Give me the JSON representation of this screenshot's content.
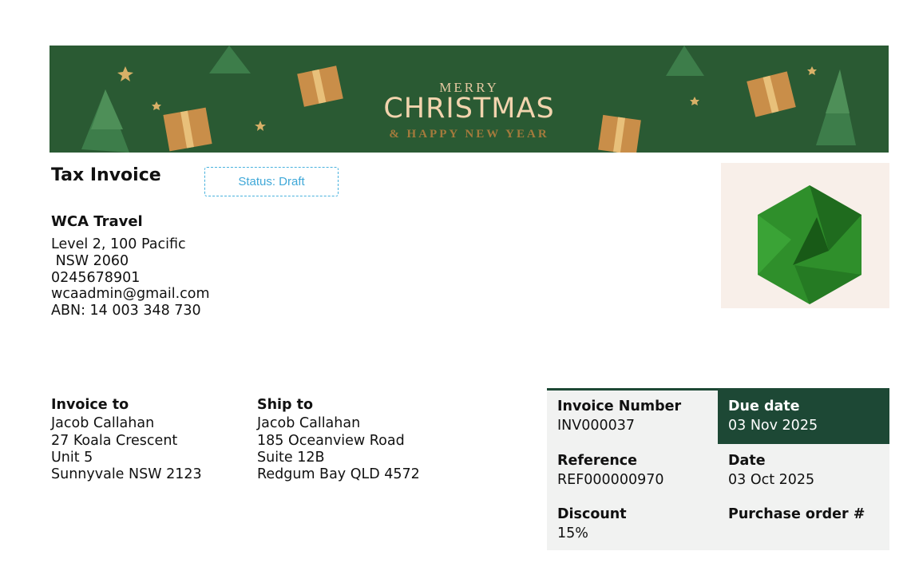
{
  "banner": {
    "line1": "MERRY",
    "line2": "CHRISTMAS",
    "line3": "& HAPPY NEW YEAR"
  },
  "document": {
    "title": "Tax Invoice",
    "status": "Status: Draft"
  },
  "company": {
    "name": "WCA Travel",
    "address_line1": "Level 2, 100 Pacific",
    "address_line2": " NSW 2060",
    "phone": "0245678901",
    "email": "wcaadmin@gmail.com",
    "abn": "ABN: 14 003 348 730"
  },
  "invoice_to": {
    "heading": "Invoice to",
    "lines": [
      "Jacob Callahan",
      "27 Koala Crescent",
      "Unit 5",
      "Sunnyvale NSW 2123"
    ]
  },
  "ship_to": {
    "heading": "Ship to",
    "lines": [
      "Jacob Callahan",
      "185 Oceanview Road",
      "Suite 12B",
      "Redgum Bay QLD 4572"
    ]
  },
  "details": {
    "invoice_number_label": "Invoice Number",
    "invoice_number": "INV000037",
    "due_date_label": "Due date",
    "due_date": "03 Nov 2025",
    "reference_label": "Reference",
    "reference": "REF000000970",
    "date_label": "Date",
    "date": "03 Oct 2025",
    "discount_label": "Discount",
    "discount": "15%",
    "purchase_order_label": "Purchase order #"
  },
  "colors": {
    "banner_green": "#2a5a33",
    "panel_dark_green": "#1d4835",
    "status_blue": "#49b2de",
    "logo_green": "#2f8f2b",
    "panel_grey": "#f1f2f1"
  }
}
